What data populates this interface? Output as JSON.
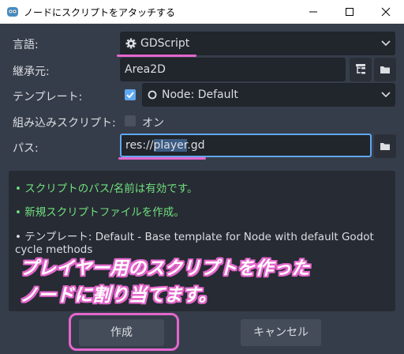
{
  "window": {
    "title": "ノードにスクリプトをアタッチする",
    "icon": "godot-icon"
  },
  "form": {
    "language": {
      "label": "言語:",
      "value": "GDScript",
      "icon": "gear-icon"
    },
    "inherits": {
      "label": "継承元:",
      "value": "Area2D"
    },
    "template": {
      "label": "テンプレート:",
      "checked": true,
      "value": "Node: Default"
    },
    "builtin": {
      "label": "組み込みスクリプト:",
      "checked": false,
      "value": "オン"
    },
    "path": {
      "label": "パス:",
      "prefix": "res://",
      "selected": "player",
      "suffix": ".gd"
    }
  },
  "messages": {
    "line1": "• スクリプトのパス/名前は有効です。",
    "line2": "• 新規スクリプトファイルを作成。",
    "line3a": "• テンプレート: Default - Base template for Node with default Godot",
    "line3b": "cycle methods"
  },
  "annotation": {
    "line1": "プレイヤー用のスクリプトを作った",
    "line2": "ノードに割り当てます。"
  },
  "buttons": {
    "create": "作成",
    "cancel": "キャンセル"
  },
  "colors": {
    "accent": "#5fa8f2",
    "highlight": "#e466cc",
    "ok_text": "#6fe07f"
  }
}
